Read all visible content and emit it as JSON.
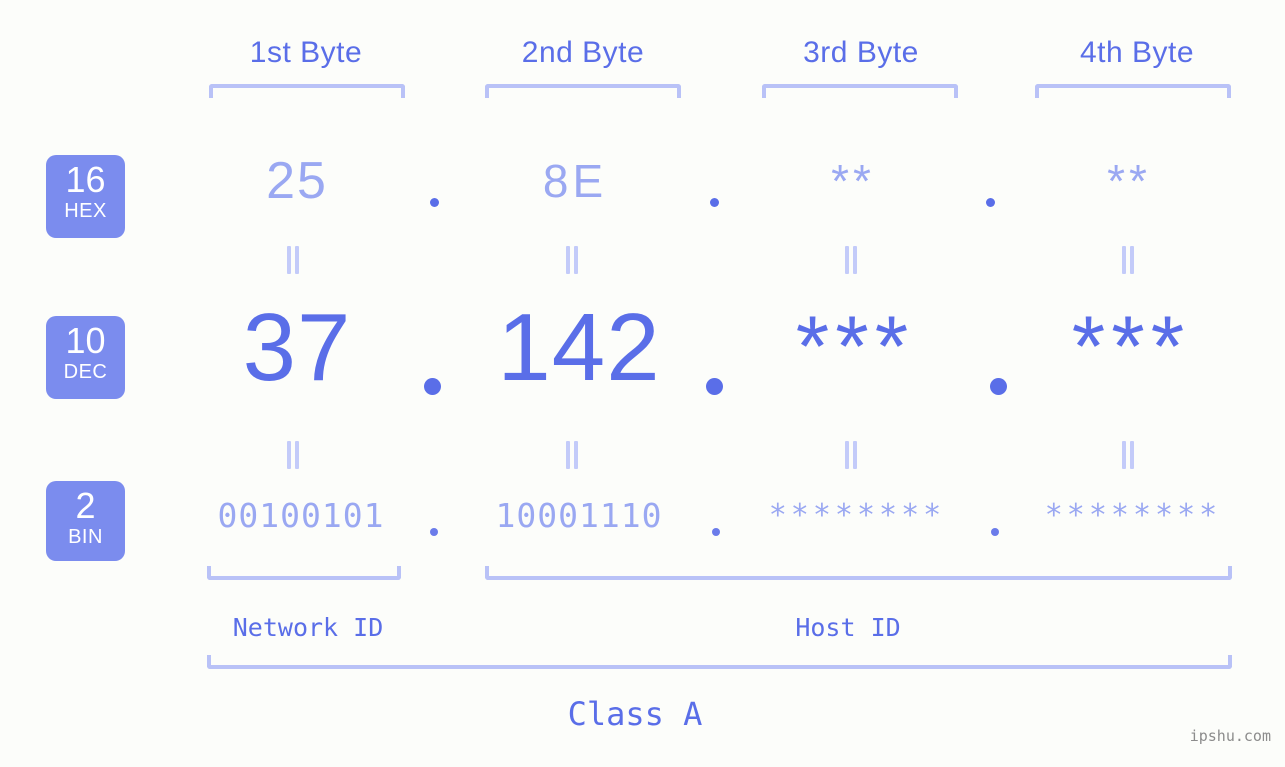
{
  "watermark": "ipshu.com",
  "bytes": [
    {
      "label": "1st Byte"
    },
    {
      "label": "2nd Byte"
    },
    {
      "label": "3rd Byte"
    },
    {
      "label": "4th Byte"
    }
  ],
  "bases": [
    {
      "num": "16",
      "abbr": "HEX"
    },
    {
      "num": "10",
      "abbr": "DEC"
    },
    {
      "num": "2",
      "abbr": "BIN"
    }
  ],
  "rows": {
    "hex": {
      "values": [
        "25",
        "8E",
        "**",
        "**"
      ],
      "separators": [
        ".",
        ".",
        "."
      ]
    },
    "dec": {
      "values": [
        "37",
        "142",
        "***",
        "***"
      ],
      "separators": [
        ".",
        ".",
        "."
      ]
    },
    "bin": {
      "values": [
        "00100101",
        "10001110",
        "********",
        "********"
      ],
      "separators": [
        ".",
        ".",
        "."
      ]
    }
  },
  "equality_marks": [
    "||",
    "||",
    "||",
    "||",
    "||",
    "||",
    "||",
    "||"
  ],
  "segments": {
    "network_id": "Network ID",
    "host_id": "Host ID",
    "class": "Class A"
  },
  "colors": {
    "background": "#fcfdfa",
    "accent_strong": "#5a6ee8",
    "accent_light": "#9aa8f2",
    "bracket": "#b9c2f7",
    "badge_bg": "#7b8cee",
    "badge_text": "#ffffff",
    "watermark": "#8c8c8c"
  }
}
